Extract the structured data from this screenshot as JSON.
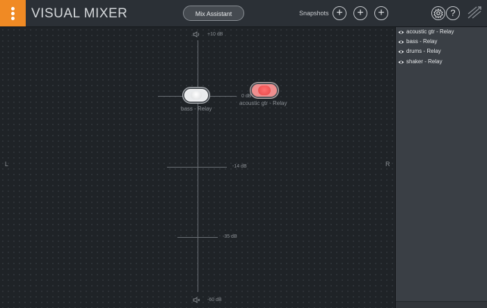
{
  "app": {
    "title": "VISUAL MIXER"
  },
  "toolbar": {
    "mix_assistant_label": "Mix Assistant",
    "snapshots_label": "Snapshots",
    "snapshot_buttons": [
      "+",
      "+",
      "+"
    ],
    "help_label": "?"
  },
  "stage": {
    "left_label": "L",
    "right_label": "R",
    "db_top": "+10 dB",
    "db_zero": "0 dB",
    "db_mid": "-14 dB",
    "db_low": "-35 dB",
    "db_bottom": "-60 dB"
  },
  "nodes": [
    {
      "label": "bass - Relay",
      "color": "#e9ebed"
    },
    {
      "label": "acoustic gtr - Relay",
      "color": "#e74848"
    }
  ],
  "tracks": [
    {
      "label": "acoustic gtr - Relay"
    },
    {
      "label": "bass - Relay"
    },
    {
      "label": "drums - Relay"
    },
    {
      "label": "shaker - Relay"
    }
  ],
  "colors": {
    "accent": "#f08a24",
    "background": "#1f2327",
    "sidebar": "#3a3f45"
  }
}
